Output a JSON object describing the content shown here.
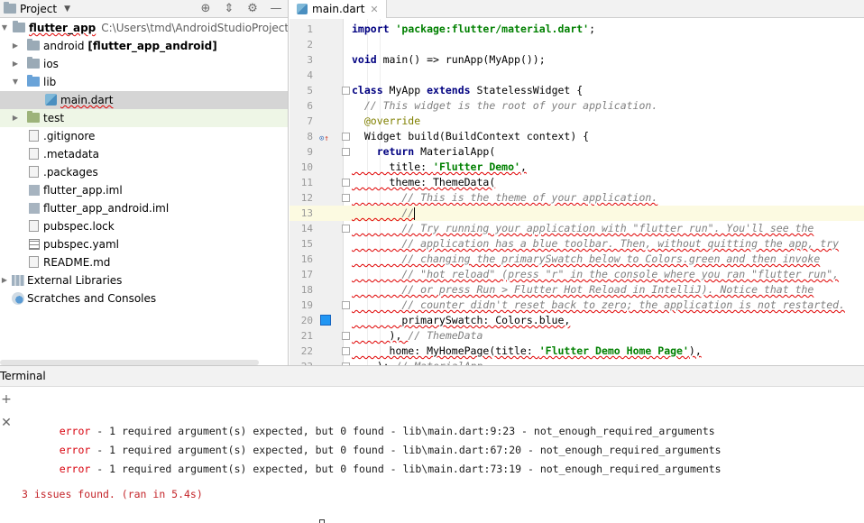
{
  "project_panel": {
    "title": "Project",
    "tree": [
      {
        "label": "flutter_app",
        "path": "C:\\Users\\tmd\\AndroidStudioProjects\\flutt"
      },
      {
        "label": "android",
        "suffix": "[flutter_app_android]"
      },
      {
        "label": "ios"
      },
      {
        "label": "lib"
      },
      {
        "label": "main.dart"
      },
      {
        "label": "test"
      },
      {
        "label": ".gitignore"
      },
      {
        "label": ".metadata"
      },
      {
        "label": ".packages"
      },
      {
        "label": "flutter_app.iml"
      },
      {
        "label": "flutter_app_android.iml"
      },
      {
        "label": "pubspec.lock"
      },
      {
        "label": "pubspec.yaml"
      },
      {
        "label": "README.md"
      },
      {
        "label": "External Libraries"
      },
      {
        "label": "Scratches and Consoles"
      }
    ]
  },
  "editor": {
    "tab": "main.dart",
    "lines": [
      {
        "n": "1",
        "parts": [
          [
            "kw",
            "import "
          ],
          [
            "str",
            "'package:flutter/material.dart'"
          ],
          [
            "",
            "; "
          ]
        ]
      },
      {
        "n": "2",
        "parts": []
      },
      {
        "n": "3",
        "parts": [
          [
            "kw",
            "void "
          ],
          [
            "",
            "main() => runApp(MyApp());"
          ]
        ]
      },
      {
        "n": "4",
        "parts": []
      },
      {
        "n": "5",
        "parts": [
          [
            "kw",
            "class "
          ],
          [
            "",
            "MyApp "
          ],
          [
            "kw",
            "extends "
          ],
          [
            "",
            "StatelessWidget {"
          ]
        ]
      },
      {
        "n": "6",
        "parts": [
          [
            "cmt",
            "  // This widget is the root of your application."
          ]
        ]
      },
      {
        "n": "7",
        "parts": [
          [
            "ann",
            "  @override"
          ]
        ]
      },
      {
        "n": "8",
        "parts": [
          [
            "",
            "  Widget build(BuildContext context) {"
          ]
        ]
      },
      {
        "n": "9",
        "parts": [
          [
            "kw",
            "    return "
          ],
          [
            "",
            "MaterialApp("
          ]
        ]
      },
      {
        "n": "10",
        "parts": [
          [
            "err",
            "      title: "
          ],
          [
            "err str",
            "'Flutter Demo'"
          ],
          [
            "err",
            ","
          ]
        ]
      },
      {
        "n": "11",
        "parts": [
          [
            "err",
            "      theme: ThemeData("
          ]
        ]
      },
      {
        "n": "12",
        "parts": [
          [
            "err cmt",
            "        // This is the theme of your application."
          ]
        ]
      },
      {
        "n": "13",
        "parts": [
          [
            "err cmt",
            "        //"
          ]
        ]
      },
      {
        "n": "14",
        "parts": [
          [
            "err cmt",
            "        // Try running your application with \"flutter run\". You'll see the"
          ]
        ]
      },
      {
        "n": "15",
        "parts": [
          [
            "err cmt",
            "        // application has a blue toolbar. Then, without quitting the app, try"
          ]
        ]
      },
      {
        "n": "16",
        "parts": [
          [
            "err cmt",
            "        // changing the primarySwatch below to Colors.green and then invoke"
          ]
        ]
      },
      {
        "n": "17",
        "parts": [
          [
            "err cmt",
            "        // \"hot reload\" (press \"r\" in the console where you ran \"flutter run\","
          ]
        ]
      },
      {
        "n": "18",
        "parts": [
          [
            "err cmt",
            "        // or press Run > Flutter Hot Reload in IntelliJ). Notice that the"
          ]
        ]
      },
      {
        "n": "19",
        "parts": [
          [
            "err cmt",
            "        // counter didn't reset back to zero; the application is not restarted."
          ]
        ]
      },
      {
        "n": "20",
        "parts": [
          [
            "err",
            "        primarySwatch: Colors.blue,"
          ]
        ]
      },
      {
        "n": "21",
        "parts": [
          [
            "err",
            "      ), "
          ],
          [
            "cmt",
            "// ThemeData"
          ]
        ]
      },
      {
        "n": "22",
        "parts": [
          [
            "err",
            "      home: MyHomePage(title: "
          ],
          [
            "err str",
            "'Flutter Demo Home Page'"
          ],
          [
            "err",
            "),"
          ]
        ]
      },
      {
        "n": "23",
        "parts": [
          [
            "",
            "    ); "
          ],
          [
            "cmt",
            "// MaterialApp"
          ]
        ]
      }
    ]
  },
  "terminal": {
    "title": "Terminal",
    "errors": [
      {
        "level": "error",
        "text": " - 1 required argument(s) expected, but 0 found - lib\\main.dart:9:23 - not_enough_required_arguments"
      },
      {
        "level": "error",
        "text": " - 1 required argument(s) expected, but 0 found - lib\\main.dart:67:20 - not_enough_required_arguments"
      },
      {
        "level": "error",
        "text": " - 1 required argument(s) expected, but 0 found - lib\\main.dart:73:19 - not_enough_required_arguments"
      }
    ],
    "summary": "3 issues found. (ran in 5.4s)"
  },
  "colors": {
    "error_red": "#d8000c",
    "primary_swatch": "#2196f3",
    "current_line": "#fcfae1",
    "selection": "#d5d5d5"
  },
  "icons": [
    "folder-icon",
    "dart-file-icon",
    "file-icon",
    "settings-icon",
    "crosshair-icon",
    "collapse-icon",
    "minimize-icon",
    "add-icon",
    "close-icon"
  ]
}
